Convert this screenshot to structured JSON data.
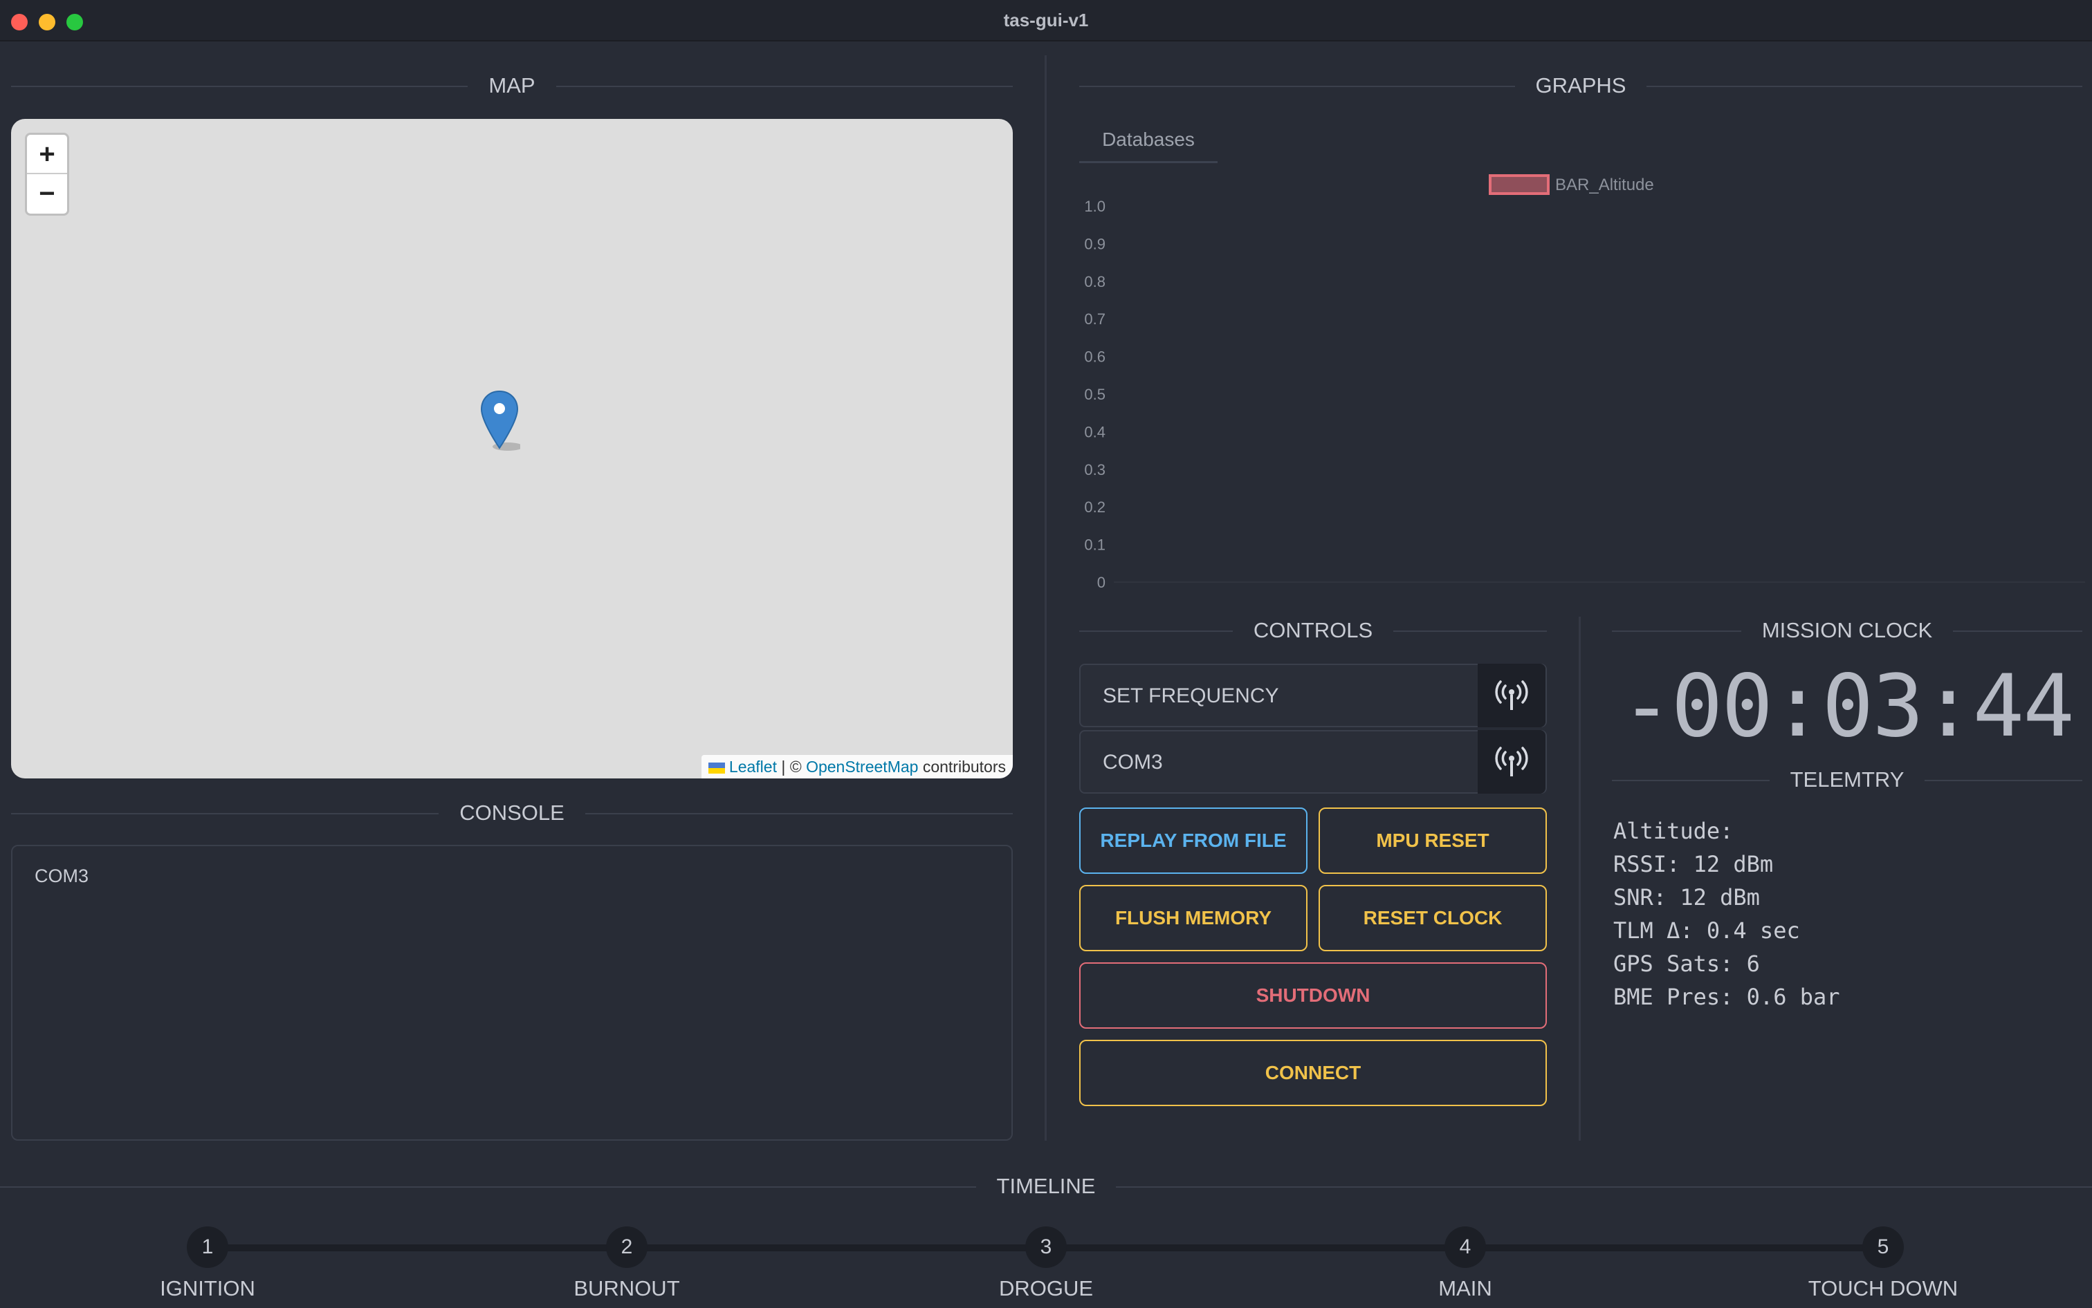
{
  "window": {
    "title": "tas-gui-v1"
  },
  "sections": {
    "map": "MAP",
    "graphs": "GRAPHS",
    "console": "CONSOLE",
    "controls": "CONTROLS",
    "mission_clock": "MISSION CLOCK",
    "telemetry": "TELEMTRY",
    "timeline": "TIMELINE"
  },
  "map": {
    "zoom_in": "+",
    "zoom_out": "−",
    "attribution": {
      "leaflet": "Leaflet",
      "sep": " | © ",
      "osm": "OpenStreetMap",
      "contributors": " contributors"
    }
  },
  "console": {
    "text": "COM3"
  },
  "graphs": {
    "tab": "Databases",
    "chart_data": {
      "type": "bar",
      "series": [
        {
          "name": "BAR_Altitude",
          "values": []
        }
      ],
      "categories": [],
      "ylim": [
        0,
        1.0
      ],
      "yticks": [
        "1.0",
        "0.9",
        "0.8",
        "0.7",
        "0.6",
        "0.5",
        "0.4",
        "0.3",
        "0.2",
        "0.1",
        "0"
      ],
      "legend": "top-center",
      "grid": false,
      "colors": {
        "series": "#e36d78"
      }
    }
  },
  "controls": {
    "frequency": {
      "text": "SET FREQUENCY"
    },
    "port": {
      "text": "COM3"
    },
    "buttons": {
      "replay": "REPLAY FROM FILE",
      "mpu_reset": "MPU RESET",
      "flush": "FLUSH MEMORY",
      "reset_clock": "RESET CLOCK",
      "shutdown": "SHUTDOWN",
      "connect": "CONNECT"
    }
  },
  "mission_clock": {
    "value": "-00:03:44"
  },
  "telemetry": {
    "altitude": "Altitude:",
    "rssi": "RSSI: 12 dBm",
    "snr": "SNR: 12 dBm",
    "tlm": "TLM Δ: 0.4 sec",
    "gps": "GPS Sats: 6",
    "bme": "BME Pres: 0.6 bar"
  },
  "timeline": {
    "steps": [
      {
        "num": "1",
        "label": "IGNITION"
      },
      {
        "num": "2",
        "label": "BURNOUT"
      },
      {
        "num": "3",
        "label": "DROGUE"
      },
      {
        "num": "4",
        "label": "MAIN"
      },
      {
        "num": "5",
        "label": "TOUCH DOWN"
      }
    ]
  },
  "colors": {
    "accent_yellow": "#f1c24a",
    "accent_blue": "#5bb3ee",
    "accent_red": "#e36d78",
    "background": "#282c36"
  }
}
